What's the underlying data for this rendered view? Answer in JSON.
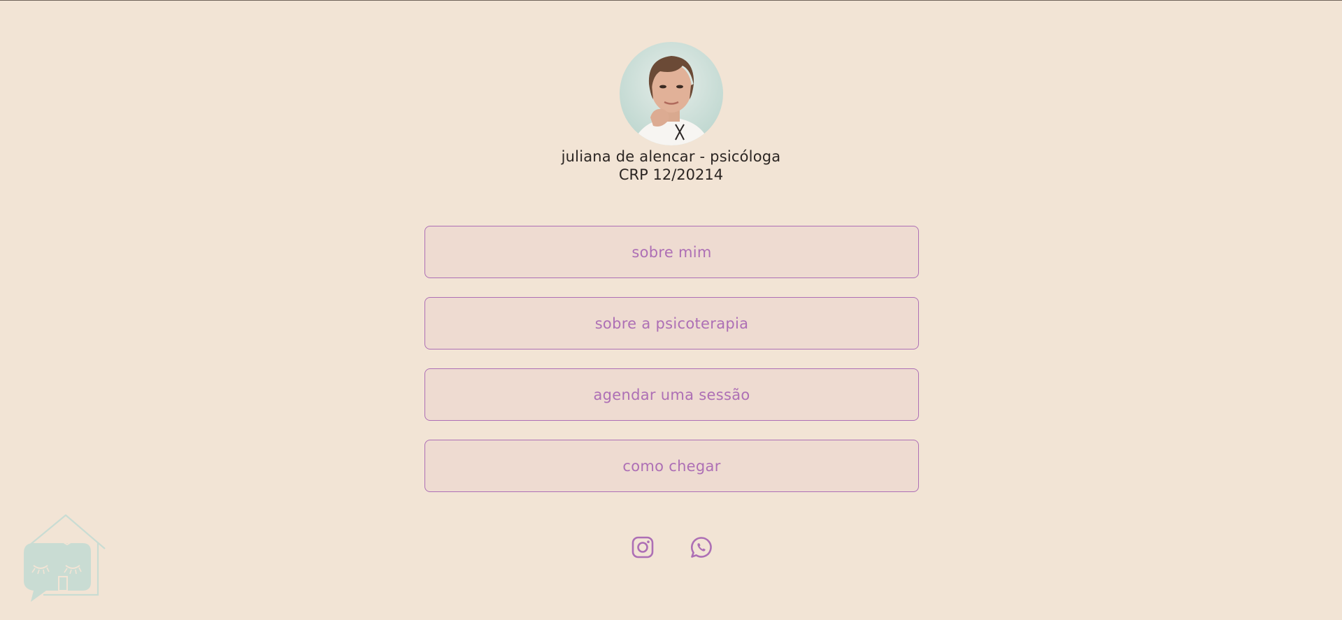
{
  "profile": {
    "name": "juliana de alencar - psicóloga",
    "registration": "CRP 12/20214"
  },
  "links": [
    {
      "label": "sobre mim"
    },
    {
      "label": "sobre a psicoterapia"
    },
    {
      "label": "agendar uma sessão"
    },
    {
      "label": "como chegar"
    }
  ],
  "social": {
    "icons": [
      "instagram-icon",
      "whatsapp-icon"
    ]
  },
  "colors": {
    "background": "#f2e4d5",
    "accent": "#ad6fb5",
    "button_fill": "#eedbd1",
    "text": "#2b2522",
    "logo": "#c9dcd3"
  }
}
